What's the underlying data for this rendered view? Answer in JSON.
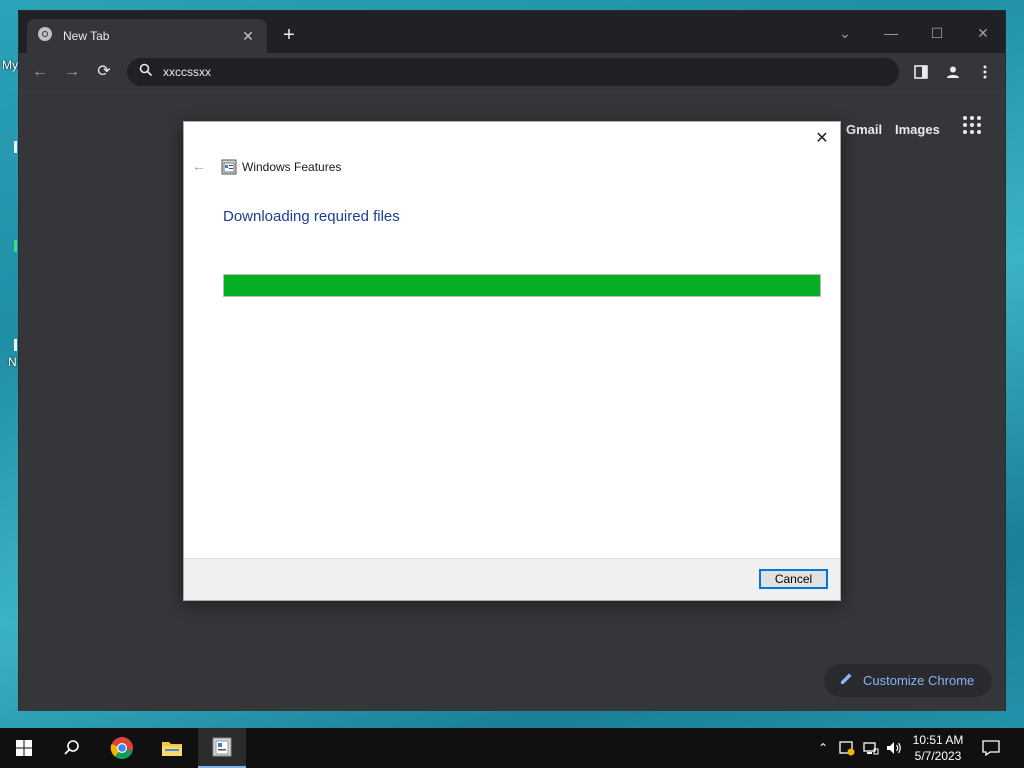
{
  "desktop": {
    "fragment_my": "My",
    "fragment_n": "N"
  },
  "browser": {
    "tab_title": "New Tab",
    "address_text": "xxccssxx",
    "ntp": {
      "gmail_label": "Gmail",
      "images_label": "Images",
      "customize_label": "Customize Chrome"
    }
  },
  "dialog": {
    "title": "Windows Features",
    "heading": "Downloading required files",
    "progress_percent": 100,
    "cancel_label": "Cancel",
    "progress_color": "#06b025"
  },
  "taskbar": {
    "time": "10:51 AM",
    "date": "5/7/2023"
  }
}
